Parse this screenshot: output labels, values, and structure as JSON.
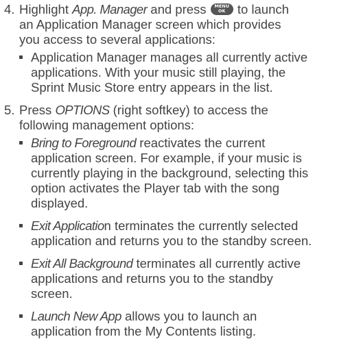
{
  "steps": [
    {
      "number": "4.",
      "highlight_verb": "Highlight",
      "term": "App. Manager",
      "before_key": "and press",
      "key_label_top": "MENU",
      "key_label_bottom": "OK",
      "after_key_line1": "to launch",
      "line2": "an Application Manager screen which provides",
      "line3": "you access to several applications:",
      "bullets": [
        {
          "lines": [
            "Application Manager manages all currently active",
            "applications. With your music still playing, the",
            "Sprint Music Store entry appears in the list."
          ]
        }
      ]
    },
    {
      "number": "5.",
      "press_verb": "Press",
      "term": "OPTIONS",
      "after_term": "(right softkey) to access the",
      "line2": "following management options:",
      "bullets": [
        {
          "term": "Bring to Foreground",
          "first_line_rest": "reactivates the current",
          "lines": [
            "application screen. For example, if your music is",
            "currently playing in the background, selecting this",
            "option activates the Player tab with the song",
            "displayed."
          ]
        },
        {
          "term": "Exit Applicatio",
          "first_line_rest": "n terminates the currently selected",
          "lines": [
            "application and returns you to the standby screen."
          ]
        },
        {
          "term": "Exit All Background",
          "first_line_rest": "terminates all currently active",
          "lines": [
            "applications and returns you to the standby",
            "screen."
          ]
        },
        {
          "term": "Launch New App",
          "first_line_rest": "allows you to launch an",
          "lines": [
            "application from the My Contents listing."
          ]
        }
      ]
    }
  ]
}
